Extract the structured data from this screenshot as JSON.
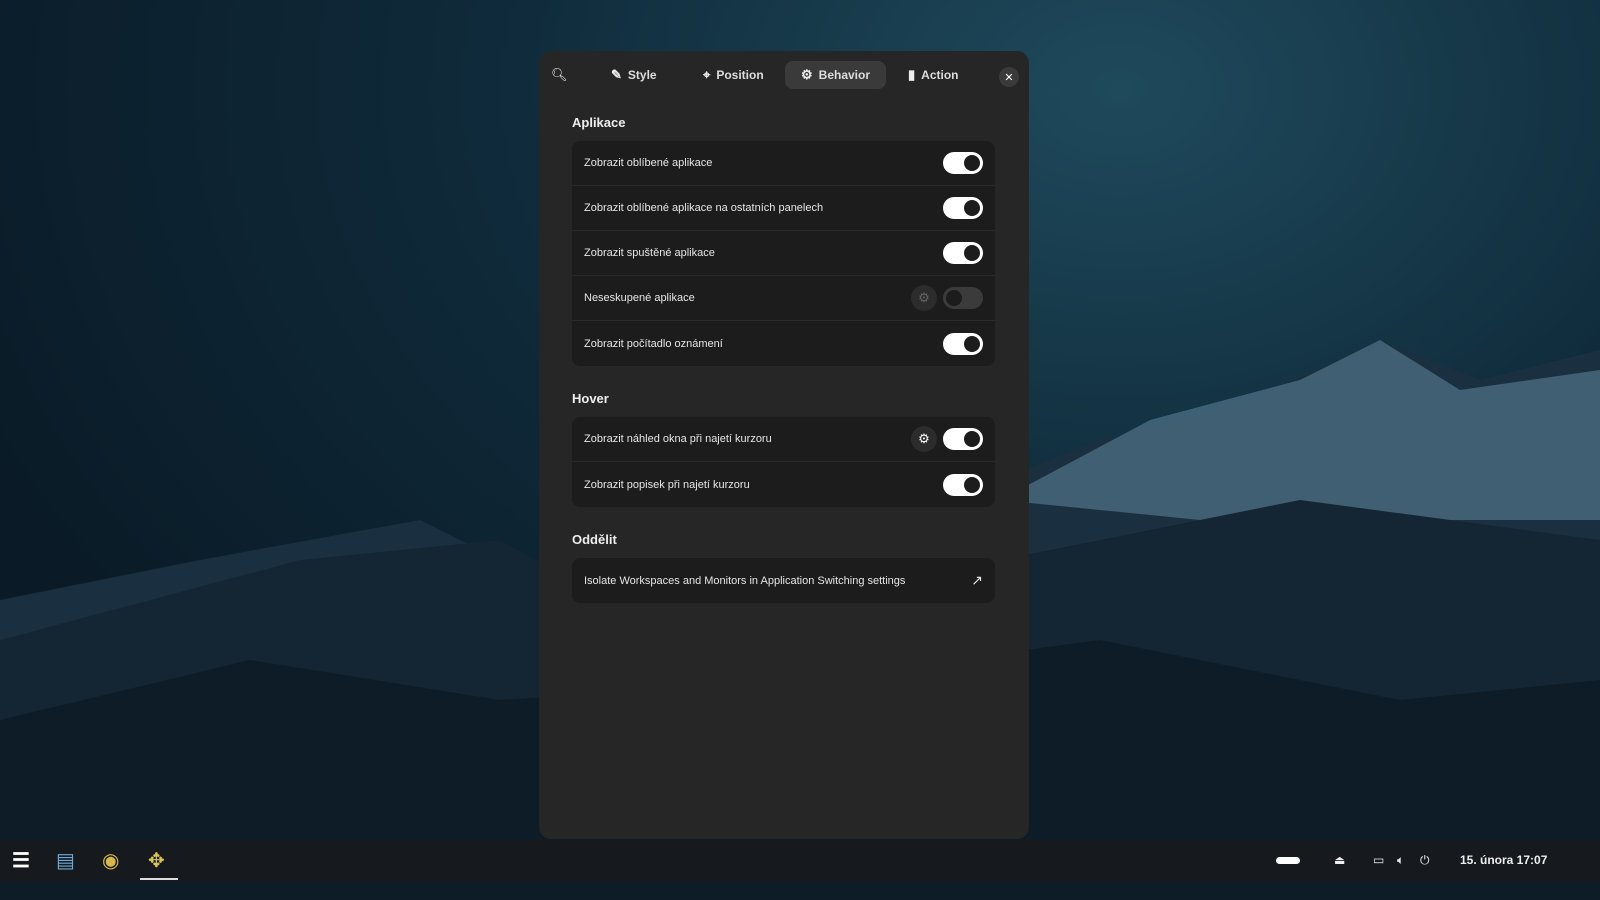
{
  "tabs": [
    {
      "label": "Style",
      "icon": "brush-icon"
    },
    {
      "label": "Position",
      "icon": "crosshair-icon"
    },
    {
      "label": "Behavior",
      "icon": "gear-icon"
    },
    {
      "label": "Action",
      "icon": "mouse-icon"
    }
  ],
  "active_tab": "Behavior",
  "sections": {
    "apps": {
      "title": "Aplikace",
      "rows": [
        {
          "label": "Zobrazit oblíbené aplikace",
          "on": true
        },
        {
          "label": "Zobrazit oblíbené aplikace na ostatních panelech",
          "on": true
        },
        {
          "label": "Zobrazit spuštěné aplikace",
          "on": true
        },
        {
          "label": "Neseskupené aplikace",
          "on": false,
          "settings": true
        },
        {
          "label": "Zobrazit počítadlo oznámení",
          "on": true
        }
      ]
    },
    "hover": {
      "title": "Hover",
      "rows": [
        {
          "label": "Zobrazit náhled okna při najetí kurzoru",
          "on": true,
          "settings": true
        },
        {
          "label": "Zobrazit popisek při najetí kurzoru",
          "on": true
        }
      ]
    },
    "isolate": {
      "title": "Oddělit",
      "link": "Isolate Workspaces and Monitors in Application Switching settings"
    }
  },
  "taskbar": {
    "clock": "15. února  17:07"
  }
}
